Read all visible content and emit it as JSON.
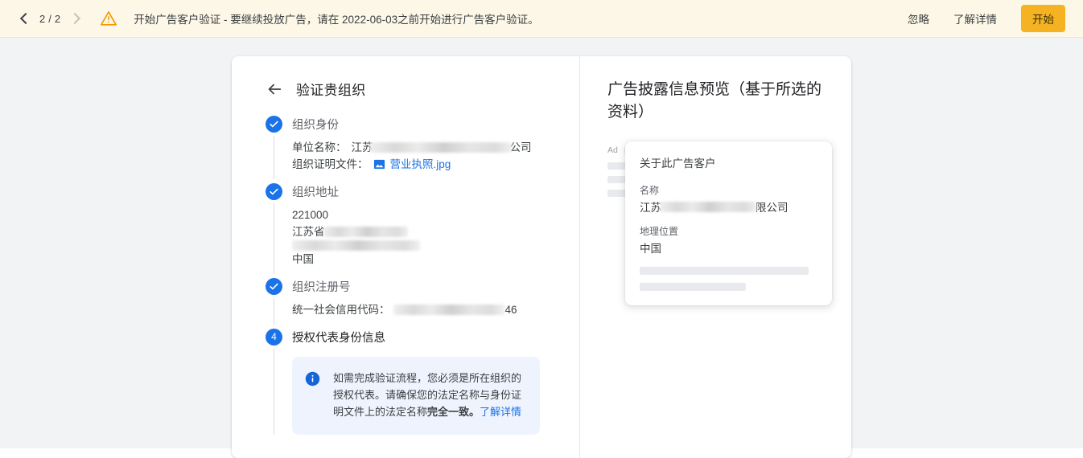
{
  "banner": {
    "pager": {
      "prev_icon": "chevron-left-icon",
      "label": "2 / 2",
      "next_icon": "chevron-right-icon"
    },
    "warning_icon": "warning-triangle-icon",
    "message": "开始广告客户验证 - 要继续投放广告，请在 2022-06-03之前开始进行广告客户验证。",
    "dismiss_label": "忽略",
    "learn_more_label": "了解详情",
    "start_label": "开始",
    "accent_color": "#f5b324",
    "background_color": "#fdf7e7"
  },
  "card": {
    "left": {
      "back_icon": "arrow-left-icon",
      "title": "验证贵组织",
      "steps": [
        {
          "badge": "check",
          "title": "组织身份",
          "fields": [
            {
              "label": "单位名称：",
              "prefix": "江苏",
              "suffix": "公司",
              "redacted": true
            },
            {
              "label": "组织证明文件：",
              "file_icon": "image-file-icon",
              "file_name": "营业执照.jpg"
            }
          ]
        },
        {
          "badge": "check",
          "title": "组织地址",
          "address": {
            "postal_code": "221000",
            "line1_prefix": "江苏省",
            "country": "中国"
          }
        },
        {
          "badge": "check",
          "title": "组织注册号",
          "fields": [
            {
              "label": "统一社会信用代码：",
              "suffix": "46",
              "redacted": true
            }
          ]
        },
        {
          "badge": "4",
          "title": "授权代表身份信息",
          "info_box": {
            "icon": "info-icon",
            "text_part1": "如需完成验证流程，您必须是所在组织的授权代表。请确保您的法定名称与身份证明文件上的法定名称",
            "text_bold": "完全一致。",
            "link": "了解详情"
          }
        }
      ]
    },
    "right": {
      "title": "广告披露信息预览（基于所选的资料）",
      "ad_label": "Ad",
      "popover": {
        "title": "关于此广告客户",
        "name_label": "名称",
        "name_prefix": "江苏",
        "name_suffix": "限公司",
        "location_label": "地理位置",
        "location_value": "中国"
      }
    }
  }
}
